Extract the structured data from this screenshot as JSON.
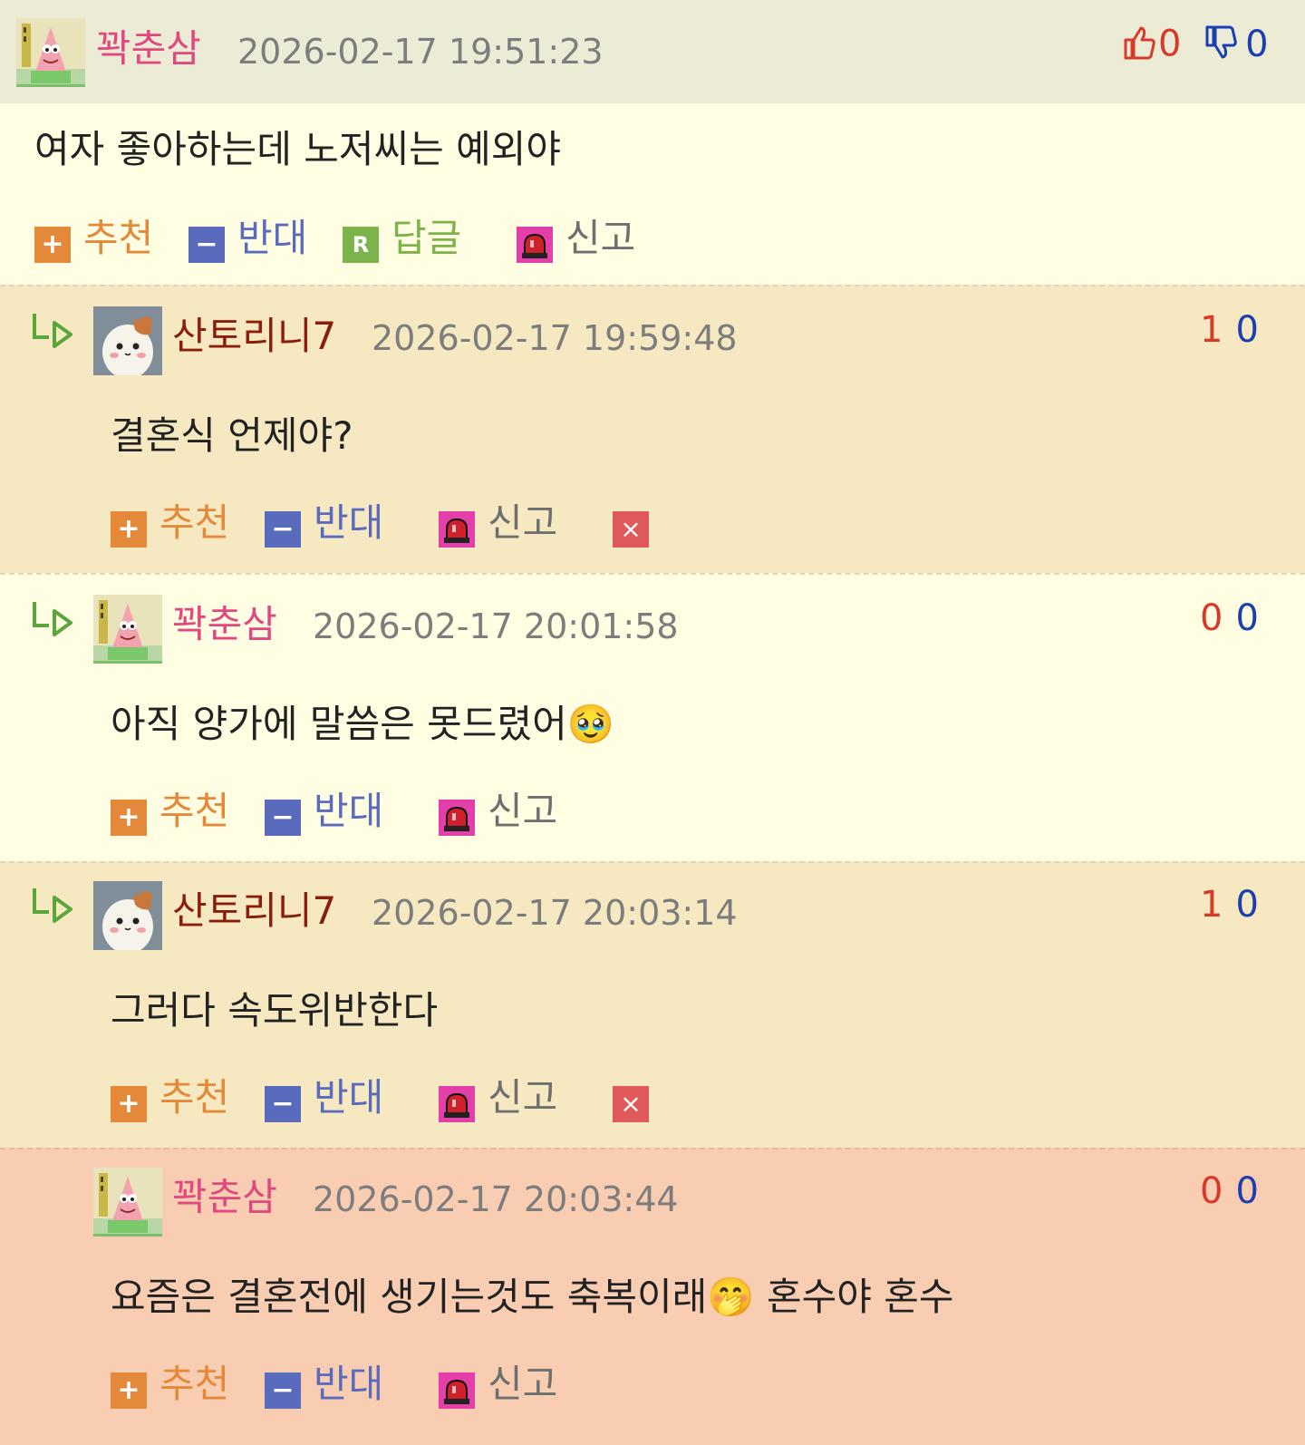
{
  "colors": {
    "header_bg": "#ecebd6",
    "body_bg": "#fffee2",
    "reply_bg": "#f6e9c1",
    "highlight_bg": "#f8cdb2",
    "nick_pink": "#e0487f",
    "nick_brown": "#8a1d0b",
    "upvote": "#d83a2a",
    "downvote": "#1b3fb0",
    "recommend": "#e4893a",
    "oppose": "#5a6bbd",
    "reply": "#7cb34a",
    "report": "#e43fa8",
    "delete": "#e05a5a"
  },
  "actions": {
    "recommend": "추천",
    "oppose": "반대",
    "reply": "답글",
    "report": "신고",
    "recommend_icon": "+",
    "oppose_icon": "−",
    "reply_icon": "R",
    "delete_icon": "×"
  },
  "main_comment": {
    "nickname": "꽉춘삼",
    "avatar": "patrick-avatar",
    "timestamp": "2026-02-17 19:51:23",
    "upvotes": "0",
    "downvotes": "0",
    "text": "여자 좋아하는데 노저씨는 예외야"
  },
  "replies": [
    {
      "nickname": "산토리니7",
      "avatar": "hamster-avatar",
      "timestamp": "2026-02-17 19:59:48",
      "upvotes": "1",
      "downvotes": "0",
      "text": "결혼식 언제야?",
      "deletable": true
    },
    {
      "nickname": "꽉춘삼",
      "avatar": "patrick-avatar",
      "timestamp": "2026-02-17 20:01:58",
      "upvotes": "0",
      "downvotes": "0",
      "text": "아직 양가에 말씀은 못드렸어🥹",
      "deletable": false
    },
    {
      "nickname": "산토리니7",
      "avatar": "hamster-avatar",
      "timestamp": "2026-02-17 20:03:14",
      "upvotes": "1",
      "downvotes": "0",
      "text": "그러다 속도위반한다",
      "deletable": true
    },
    {
      "nickname": "꽉춘삼",
      "avatar": "patrick-avatar",
      "timestamp": "2026-02-17 20:03:44",
      "upvotes": "0",
      "downvotes": "0",
      "text": "요즘은 결혼전에 생기는것도 축복이래🤭 혼수야 혼수",
      "deletable": false
    }
  ]
}
